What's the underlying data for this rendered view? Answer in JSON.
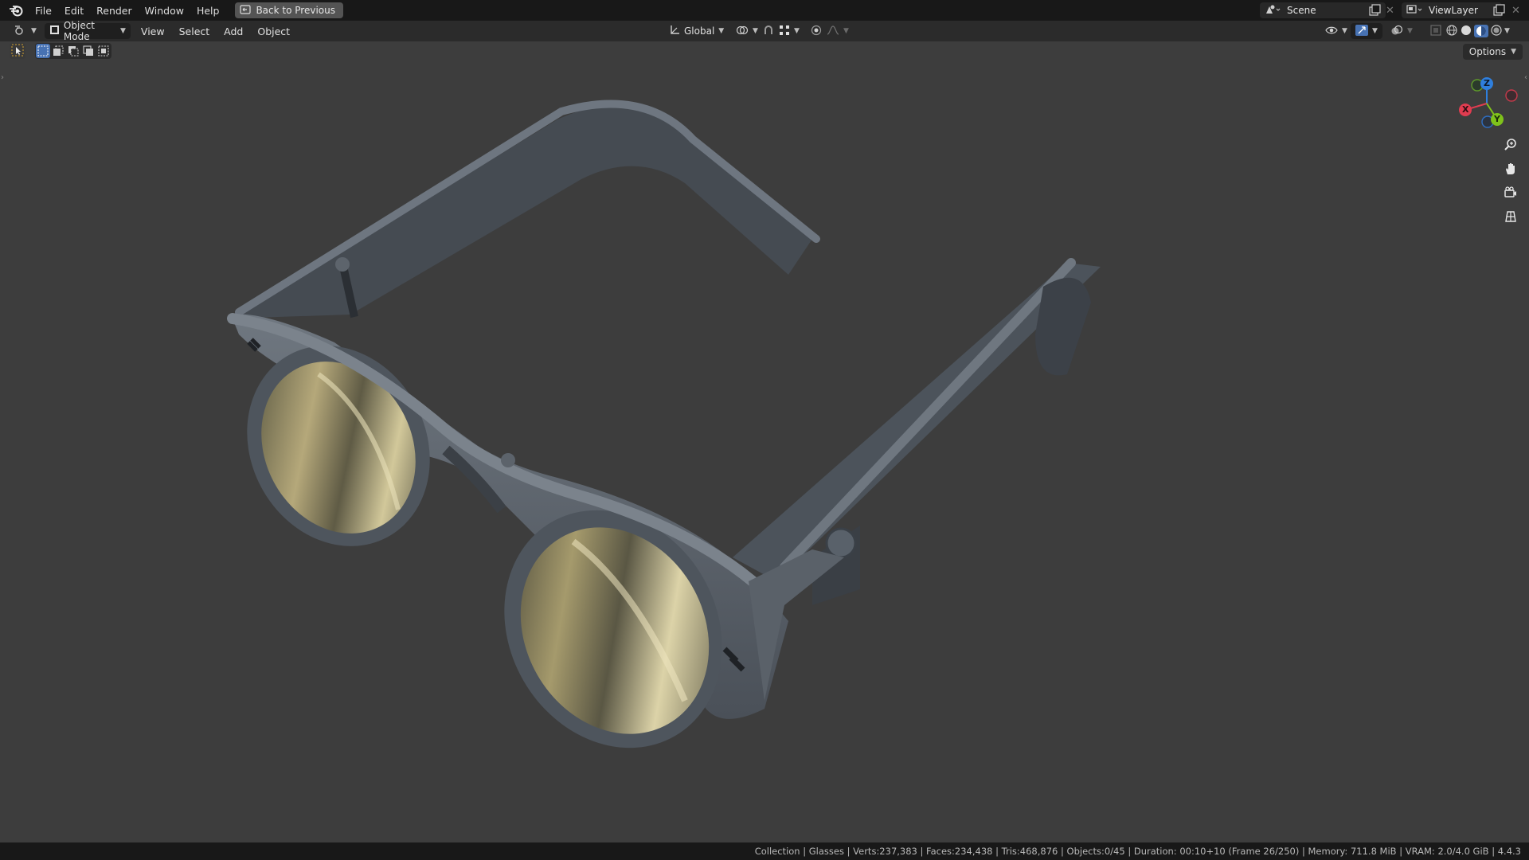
{
  "topbar": {
    "menus": [
      "File",
      "Edit",
      "Render",
      "Window",
      "Help"
    ],
    "back_button": "Back to Previous",
    "scene_name": "Scene",
    "view_layer": "ViewLayer"
  },
  "header": {
    "mode": "Object Mode",
    "menus": [
      "View",
      "Select",
      "Add",
      "Object"
    ],
    "transform_orientation": "Global"
  },
  "options_label": "Options",
  "gizmo": {
    "z": "Z",
    "x": "X",
    "y": "Y"
  },
  "colors": {
    "accent_blue": "#4772b3",
    "axis_x": "#e03c50",
    "axis_y": "#7fc21b",
    "axis_z": "#2f7fdd",
    "viewport_bg": "#3d3d3d"
  },
  "icons": [
    "blender-logo-icon",
    "back-icon",
    "editor-type-icon",
    "object-mode-icon",
    "cursor-tool-icon",
    "select-box-icons",
    "transform-icon",
    "pivot-icon",
    "snap-icon",
    "proportional-icon",
    "visibility-icon",
    "gizmo-icon",
    "overlay-icon",
    "xray-icon",
    "shading-icons",
    "zoom-icon",
    "pan-hand-icon",
    "camera-icon",
    "grid-icon",
    "scene-icon",
    "viewlayer-icon",
    "pin-icon",
    "new-icon",
    "close-icon"
  ],
  "status": "Collection | Glasses | Verts:237,383 | Faces:234,438 | Tris:468,876 | Objects:0/45 | Duration: 00:10+10 (Frame 26/250) | Memory: 711.8 MiB | VRAM: 2.0/4.0 GiB | 4.4.3"
}
